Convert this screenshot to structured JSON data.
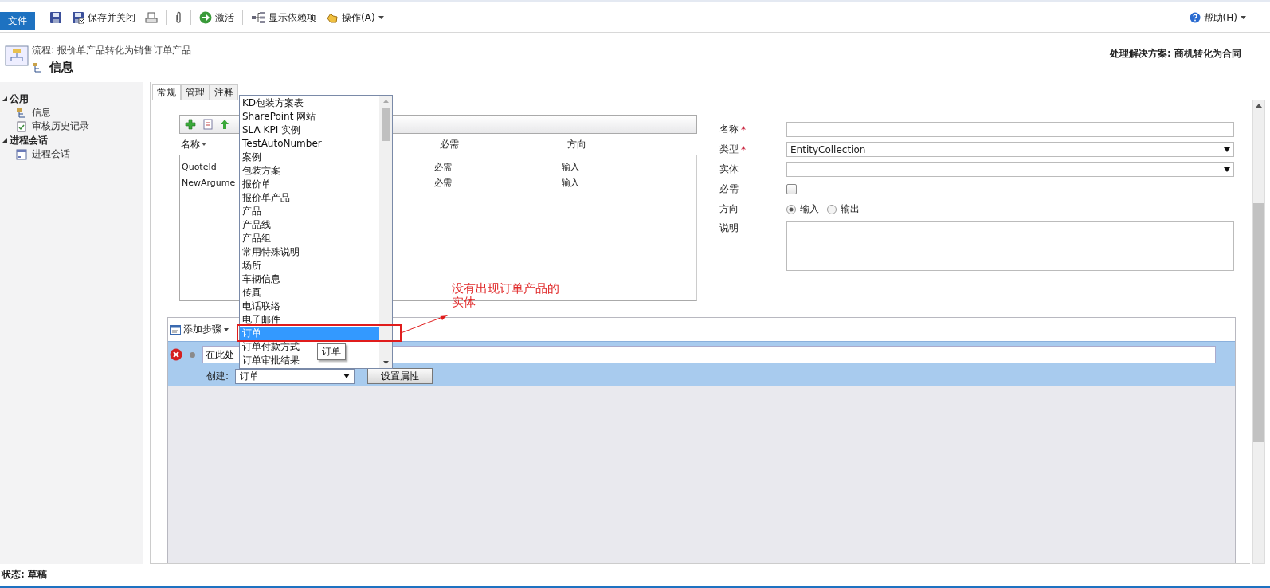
{
  "toolbar": {
    "file_tab": "文件",
    "buttons": [
      {
        "label": "保存并关闭"
      },
      {
        "label": "激活"
      },
      {
        "label": "显示依赖项"
      },
      {
        "label": "操作(A)"
      }
    ],
    "help": "帮助(H)"
  },
  "header": {
    "process": "流程: 报价单产品转化为销售订单产品",
    "title": "信息",
    "solution": "处理解决方案: 商机转化为合同"
  },
  "nav": {
    "groups": [
      {
        "label": "公用",
        "expanded": true,
        "items": [
          {
            "label": "信息"
          },
          {
            "label": "审核历史记录"
          }
        ]
      },
      {
        "label": "进程会话",
        "expanded": true,
        "items": [
          {
            "label": "进程会话"
          }
        ]
      }
    ]
  },
  "tabs": [
    {
      "label": "常规",
      "selected": true
    },
    {
      "label": "管理",
      "selected": false
    },
    {
      "label": "注释",
      "selected": false
    }
  ],
  "arguments": {
    "columns": [
      "名称",
      "必需",
      "方向"
    ],
    "rows": [
      [
        "QuoteId",
        "必需",
        "输入"
      ],
      [
        "NewArgume",
        "必需",
        "输入"
      ]
    ]
  },
  "properties": {
    "required_mark": "*",
    "fields": [
      {
        "kind": "text",
        "label": "名称",
        "required": true
      },
      {
        "kind": "select",
        "label": "类型",
        "required": true,
        "value": "EntityCollection"
      },
      {
        "kind": "select",
        "label": "实体",
        "required": false
      },
      {
        "kind": "checkbox",
        "label": "必需",
        "required": false,
        "checked": false
      },
      {
        "kind": "radio",
        "label": "方向",
        "required": false,
        "options": [
          {
            "label": "输入",
            "selected": true
          },
          {
            "label": "输出",
            "selected": false
          }
        ]
      },
      {
        "kind": "textarea",
        "label": "说明",
        "required": false
      }
    ]
  },
  "steps": {
    "add_step": "添加步骤",
    "description": "在此处",
    "create_label": "创建:",
    "create_value": "订单",
    "set_properties": "设置属性"
  },
  "dropdown": {
    "items": [
      {
        "label": "KD包装方案表",
        "selected": false
      },
      {
        "label": "SharePoint 网站",
        "selected": false
      },
      {
        "label": "SLA KPI 实例",
        "selected": false
      },
      {
        "label": "TestAutoNumber",
        "selected": false
      },
      {
        "label": "案例",
        "selected": false
      },
      {
        "label": "包装方案",
        "selected": false
      },
      {
        "label": "报价单",
        "selected": false
      },
      {
        "label": "报价单产品",
        "selected": false
      },
      {
        "label": "产品",
        "selected": false
      },
      {
        "label": "产品线",
        "selected": false
      },
      {
        "label": "产品组",
        "selected": false
      },
      {
        "label": "常用特殊说明",
        "selected": false
      },
      {
        "label": "场所",
        "selected": false
      },
      {
        "label": "车辆信息",
        "selected": false
      },
      {
        "label": "传真",
        "selected": false
      },
      {
        "label": "电话联络",
        "selected": false
      },
      {
        "label": "电子邮件",
        "selected": false
      },
      {
        "label": "订单",
        "selected": true
      },
      {
        "label": "订单付款方式",
        "selected": false
      },
      {
        "label": "订单审批结果",
        "selected": false
      }
    ],
    "tooltip": "订单"
  },
  "annotation": {
    "lines": [
      "没有出现订单产品的",
      "实体"
    ]
  },
  "status_bar": "状态: 草稿"
}
